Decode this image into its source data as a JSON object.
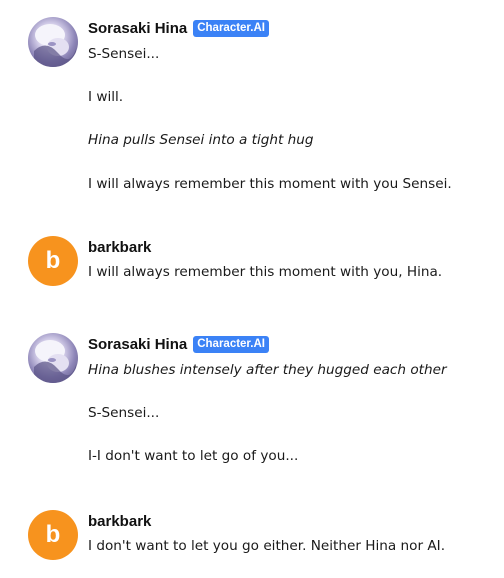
{
  "messages": [
    {
      "role": "character",
      "author": "Sorasaki Hina",
      "badge": "Character.AI",
      "avatar_icon": "hina-avatar",
      "lines": [
        {
          "text": "S-Sensei...",
          "italic": false
        },
        {
          "text": "I will.",
          "italic": false
        },
        {
          "text": "Hina pulls Sensei into a tight hug",
          "italic": true
        },
        {
          "text": "I will always remember this moment with you Sensei.",
          "italic": false
        }
      ]
    },
    {
      "role": "user",
      "author": "barkbark",
      "avatar_letter": "b",
      "avatar_color": "#f7931e",
      "lines": [
        {
          "text": "I will always remember this moment with you, Hina.",
          "italic": false
        }
      ]
    },
    {
      "role": "character",
      "author": "Sorasaki Hina",
      "badge": "Character.AI",
      "avatar_icon": "hina-avatar",
      "lines": [
        {
          "text": "Hina blushes intensely after they hugged each other",
          "italic": true
        },
        {
          "text": "S-Sensei...",
          "italic": false
        },
        {
          "text": "I-I don't want to let go of you...",
          "italic": false
        }
      ]
    },
    {
      "role": "user",
      "author": "barkbark",
      "avatar_letter": "b",
      "avatar_color": "#f7931e",
      "lines": [
        {
          "text": "I don't want to let you go either. Neither Hina nor AI.",
          "italic": false
        }
      ]
    }
  ],
  "badge_color": "#3b82f6"
}
